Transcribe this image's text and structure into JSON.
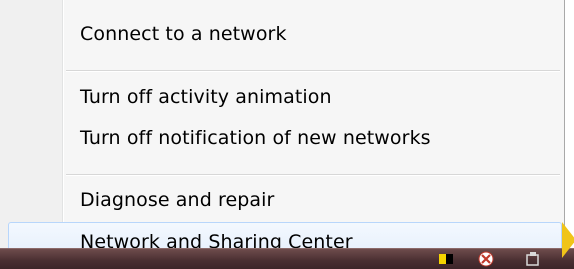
{
  "menu": {
    "items": [
      {
        "label": "Connect to a network"
      },
      {
        "label": "Turn off activity animation"
      },
      {
        "label": "Turn off notification of new networks"
      },
      {
        "label": "Diagnose and repair"
      },
      {
        "label": "Network and Sharing Center"
      }
    ]
  },
  "icons": {
    "tray": [
      "network-icon",
      "antivirus-icon",
      "volume-icon"
    ],
    "pointer": "mouse-pointer-icon"
  },
  "colors": {
    "menu_bg": "#f6f6f6",
    "hover_border": "#b8d6fb",
    "taskbar": "#4a2f32"
  }
}
